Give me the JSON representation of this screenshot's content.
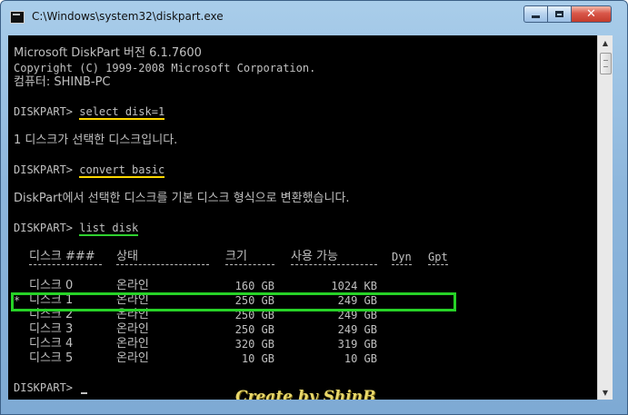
{
  "window": {
    "title": "C:\\Windows\\system32\\diskpart.exe",
    "icon": "console-app-icon"
  },
  "caption_buttons": {
    "minimize": "minimize-icon",
    "maximize": "maximize-icon",
    "close": "close-icon"
  },
  "console": {
    "header": [
      "Microsoft DiskPart 버전 6.1.7600",
      "Copyright (C) 1999-2008 Microsoft Corporation.",
      "컴퓨터: SHINB-PC"
    ],
    "prompt": "DISKPART> ",
    "commands": [
      {
        "text": "select disk=1",
        "result": "1 디스크가 선택한 디스크입니다.",
        "underline": "#ffd800"
      },
      {
        "text": "convert basic",
        "result": "DiskPart에서 선택한 디스크를 기본 디스크 형식으로 변환했습니다.",
        "underline": "#ffd800"
      },
      {
        "text": "list disk",
        "underline": "#2fd12f"
      }
    ],
    "table": {
      "headers": {
        "disk": "디스크 ###",
        "status": "상태",
        "size": "크기",
        "free": "사용 가능",
        "dyn": "Dyn",
        "gpt": "Gpt"
      },
      "rows": [
        {
          "marker": "",
          "disk": "디스크 0",
          "status": "온라인",
          "size": "160 GB",
          "free": "1024 KB"
        },
        {
          "marker": "*",
          "disk": "디스크 1",
          "status": "온라인",
          "size": "250 GB",
          "free": "249 GB"
        },
        {
          "marker": "",
          "disk": "디스크 2",
          "status": "온라인",
          "size": "250 GB",
          "free": "249 GB"
        },
        {
          "marker": "",
          "disk": "디스크 3",
          "status": "온라인",
          "size": "250 GB",
          "free": "249 GB"
        },
        {
          "marker": "",
          "disk": "디스크 4",
          "status": "온라인",
          "size": "320 GB",
          "free": "319 GB"
        },
        {
          "marker": "",
          "disk": "디스크 5",
          "status": "온라인",
          "size": "10 GB",
          "free": "10 GB"
        }
      ],
      "highlight_color": "#27d227"
    },
    "final_prompt": "DISKPART> "
  },
  "watermark": "Create by ShinB",
  "scrollbar": {
    "up": "scroll-up-arrow-icon",
    "down": "scroll-down-arrow-icon"
  },
  "colors": {
    "console_bg": "#000000",
    "console_text": "#c0c0c0",
    "window_frame": "#8db6dc"
  }
}
